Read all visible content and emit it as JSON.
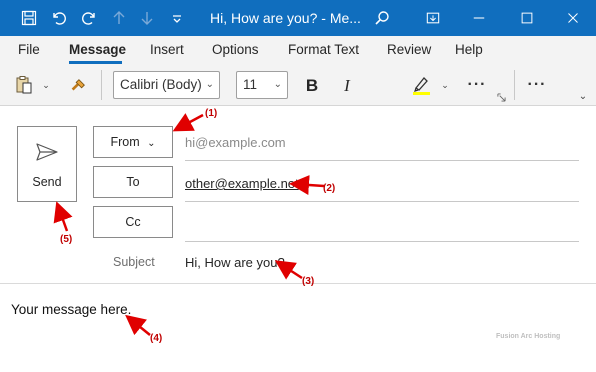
{
  "window": {
    "title": "Hi, How are you?  -  Me...",
    "accent": "#106ebe"
  },
  "menu": {
    "items": [
      "File",
      "Message",
      "Insert",
      "Options",
      "Format Text",
      "Review",
      "Help"
    ],
    "active": "Message"
  },
  "ribbon": {
    "font_name": "Calibri (Body)",
    "font_size": "11",
    "bold": "B",
    "italic": "I",
    "more1": "···",
    "more2": "···"
  },
  "form": {
    "send_label": "Send",
    "from_label": "From",
    "from_value": "hi@example.com",
    "to_label": "To",
    "to_value": "other@example.net",
    "cc_label": "Cc",
    "cc_value": "",
    "subject_label": "Subject",
    "subject_value": "Hi, How are you?"
  },
  "body": {
    "message": "Your message here.",
    "watermark": "Fusion Arc Hosting"
  },
  "annotations": {
    "a1": "(1)",
    "a2": "(2)",
    "a3": "(3)",
    "a4": "(4)",
    "a5": "(5)",
    "color": "#e00000"
  }
}
